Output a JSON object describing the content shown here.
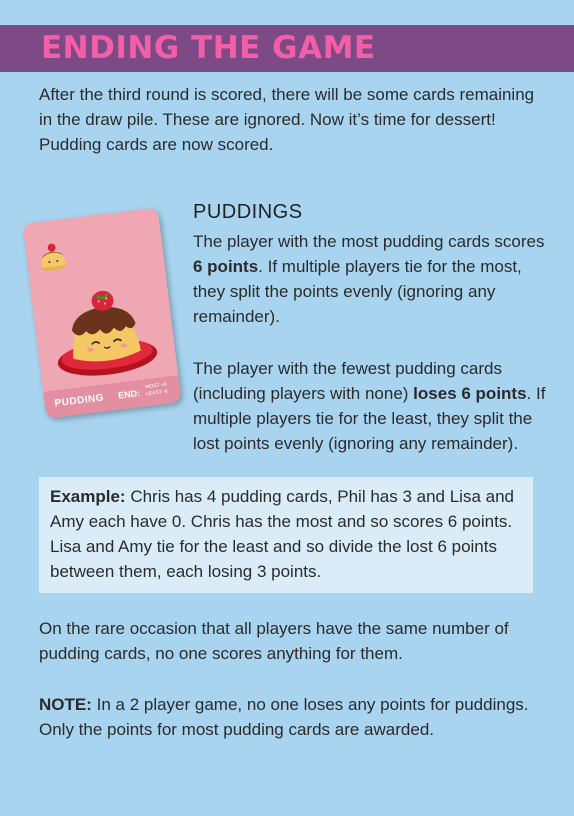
{
  "header": {
    "title": "ENDING THE GAME"
  },
  "intro": "After the third round is scored, there will be some cards remaining in the draw pile. These are ignored. Now it’s time for dessert! Pudding cards are now scored.",
  "card": {
    "name": "PUDDING",
    "end": "END:",
    "fine_print": "MOST +6 LEAST -6",
    "icon": "pudding-card-image"
  },
  "puddings": {
    "heading": "PUDDINGS",
    "p1_a": "The player with the most pudding cards scores ",
    "p1_bold": "6 points",
    "p1_b": ". If multiple players tie for the most, they split the points evenly (ignoring any remainder).",
    "p2_a": "The player with the fewest pudding cards (including players with none) ",
    "p2_bold": "loses 6 points",
    "p2_b": ". If multiple players tie for the least, they split the lost points evenly (ignoring any remainder)."
  },
  "example": {
    "label": "Example:",
    "text": " Chris has 4 pudding cards, Phil has 3 and Lisa and Amy each have 0. Chris has the most and so scores 6 points. Lisa and Amy tie for the least and so divide the lost 6 points between them, each losing 3 points."
  },
  "rare": "On the rare occasion that all players have the same number of pudding cards, no one scores anything for them.",
  "note": {
    "label": "NOTE:",
    "text": " In a 2 player game, no one loses any points for puddings. Only the points for most pudding cards are awarded."
  }
}
